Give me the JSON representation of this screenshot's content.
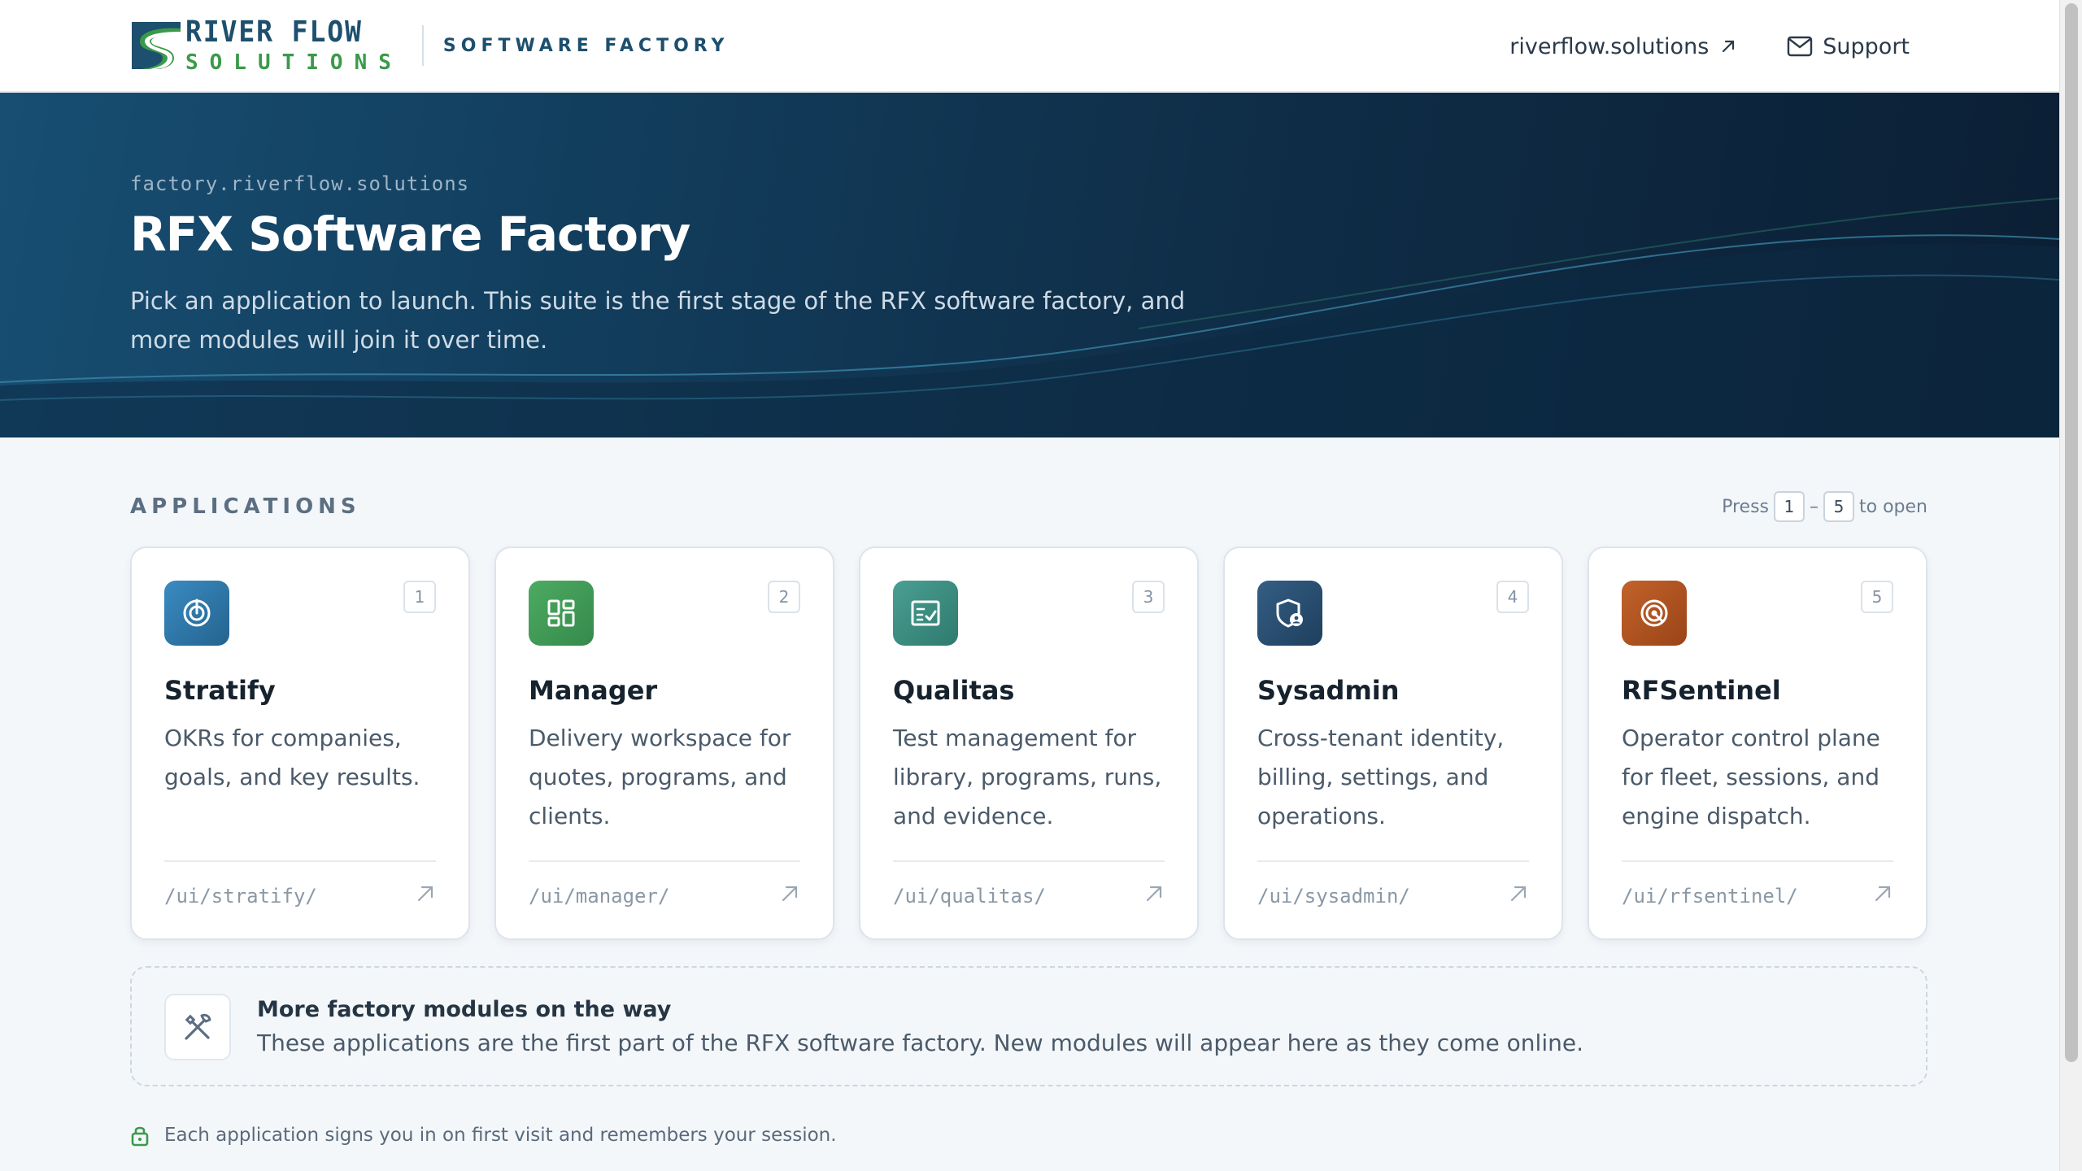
{
  "header": {
    "logo": {
      "line1": "RIVER FLOW",
      "line2": "SOLUTIONS",
      "colors": {
        "navy": "#1d4f6e",
        "green": "#3a9a4a"
      }
    },
    "subtitle": "SOFTWARE FACTORY",
    "links": {
      "site_label": "riverflow.solutions",
      "site_icon": "external-link-arrow-icon",
      "support_label": "Support",
      "support_icon": "mail-envelope-icon"
    }
  },
  "hero": {
    "domain": "factory.riverflow.solutions",
    "title": "RFX Software Factory",
    "description": "Pick an application to launch. This suite is the first stage of the RFX software factory, and more modules will join it over time."
  },
  "applications": {
    "section_title": "APPLICATIONS",
    "shortcut": {
      "prefix": "Press",
      "from": "1",
      "dash": "–",
      "to": "5",
      "suffix": "to open"
    },
    "items": [
      {
        "number": "1",
        "name": "Stratify",
        "description": "OKRs for companies, goals, and key results.",
        "path": "/ui/stratify/",
        "icon": "target-icon",
        "color": "#2f79ad"
      },
      {
        "number": "2",
        "name": "Manager",
        "description": "Delivery workspace for quotes, programs, and clients.",
        "path": "/ui/manager/",
        "icon": "dashboard-grid-icon",
        "color": "#3f9a56"
      },
      {
        "number": "3",
        "name": "Qualitas",
        "description": "Test management for library, programs, runs, and evidence.",
        "path": "/ui/qualitas/",
        "icon": "checklist-icon",
        "color": "#3b8c80"
      },
      {
        "number": "4",
        "name": "Sysadmin",
        "description": "Cross-tenant identity, billing, settings, and operations.",
        "path": "/ui/sysadmin/",
        "icon": "shield-user-icon",
        "color": "#2b4e6f"
      },
      {
        "number": "5",
        "name": "RFSentinel",
        "description": "Operator control plane for fleet, sessions, and engine dispatch.",
        "path": "/ui/rfsentinel/",
        "icon": "radar-icon",
        "color": "#b0521f"
      }
    ]
  },
  "more_modules": {
    "icon": "tools-icon",
    "title": "More factory modules on the way",
    "description": "These applications are the first part of the RFX software factory. New modules will appear here as they come online."
  },
  "footer": {
    "icon": "lock-icon",
    "note": "Each application signs you in on first visit and remembers your session."
  }
}
